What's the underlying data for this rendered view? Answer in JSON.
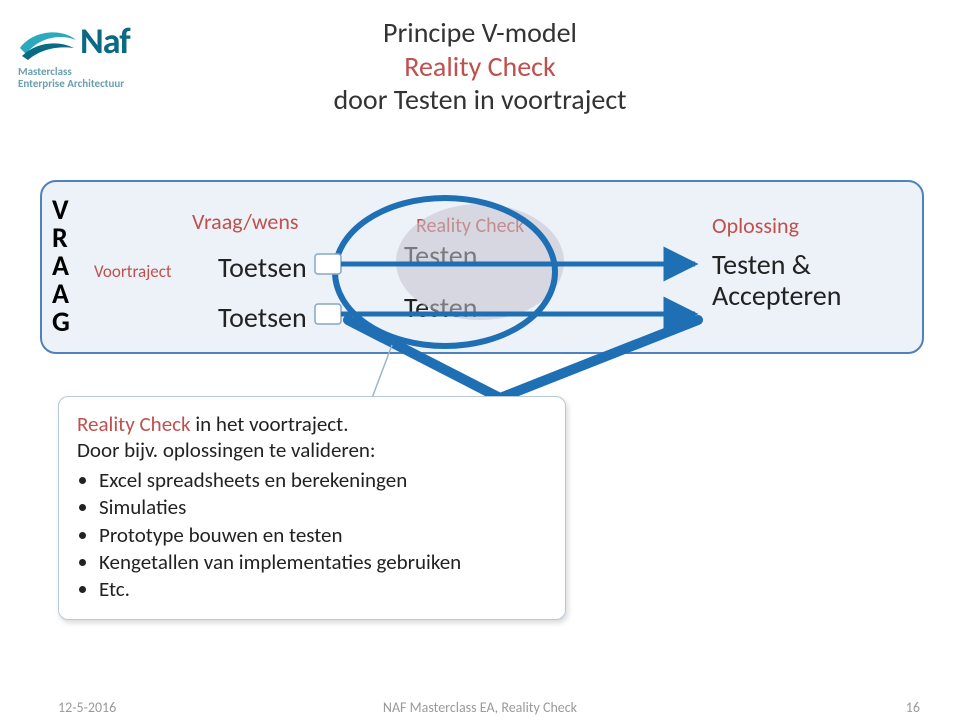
{
  "title": {
    "line1": "Principe V-model",
    "line2": "Reality Check",
    "line3": "door Testen in voortraject"
  },
  "logo": {
    "name": "Naf",
    "sub_line1": "Masterclass",
    "sub_line2": "Enterprise Architectuur"
  },
  "vmodel": {
    "vraag_letters": [
      "V",
      "R",
      "A",
      "A",
      "G"
    ],
    "voortraject": "Voortraject",
    "vraag_wens": "Vraag/wens",
    "toetsen1": "Toetsen",
    "toetsen2": "Toetsen",
    "reality_check": "Reality Check",
    "testen1": "Testen",
    "testen2": "Testen",
    "oplossing": "Oplossing",
    "testen_accept_line1": "Testen &",
    "testen_accept_line2": "Accepteren"
  },
  "note": {
    "rc_label": "Reality Check",
    "rc_suffix": " in het voortraject.",
    "line2": "Door bijv. oplossingen te valideren:",
    "bullets": [
      "Excel spreadsheets en berekeningen",
      "Simulaties",
      "Prototype bouwen en testen",
      "Kengetallen van implementaties gebruiken",
      "Etc."
    ]
  },
  "footer": {
    "date": "12-5-2016",
    "center": "NAF Masterclass EA, Reality Check",
    "page": "16"
  }
}
